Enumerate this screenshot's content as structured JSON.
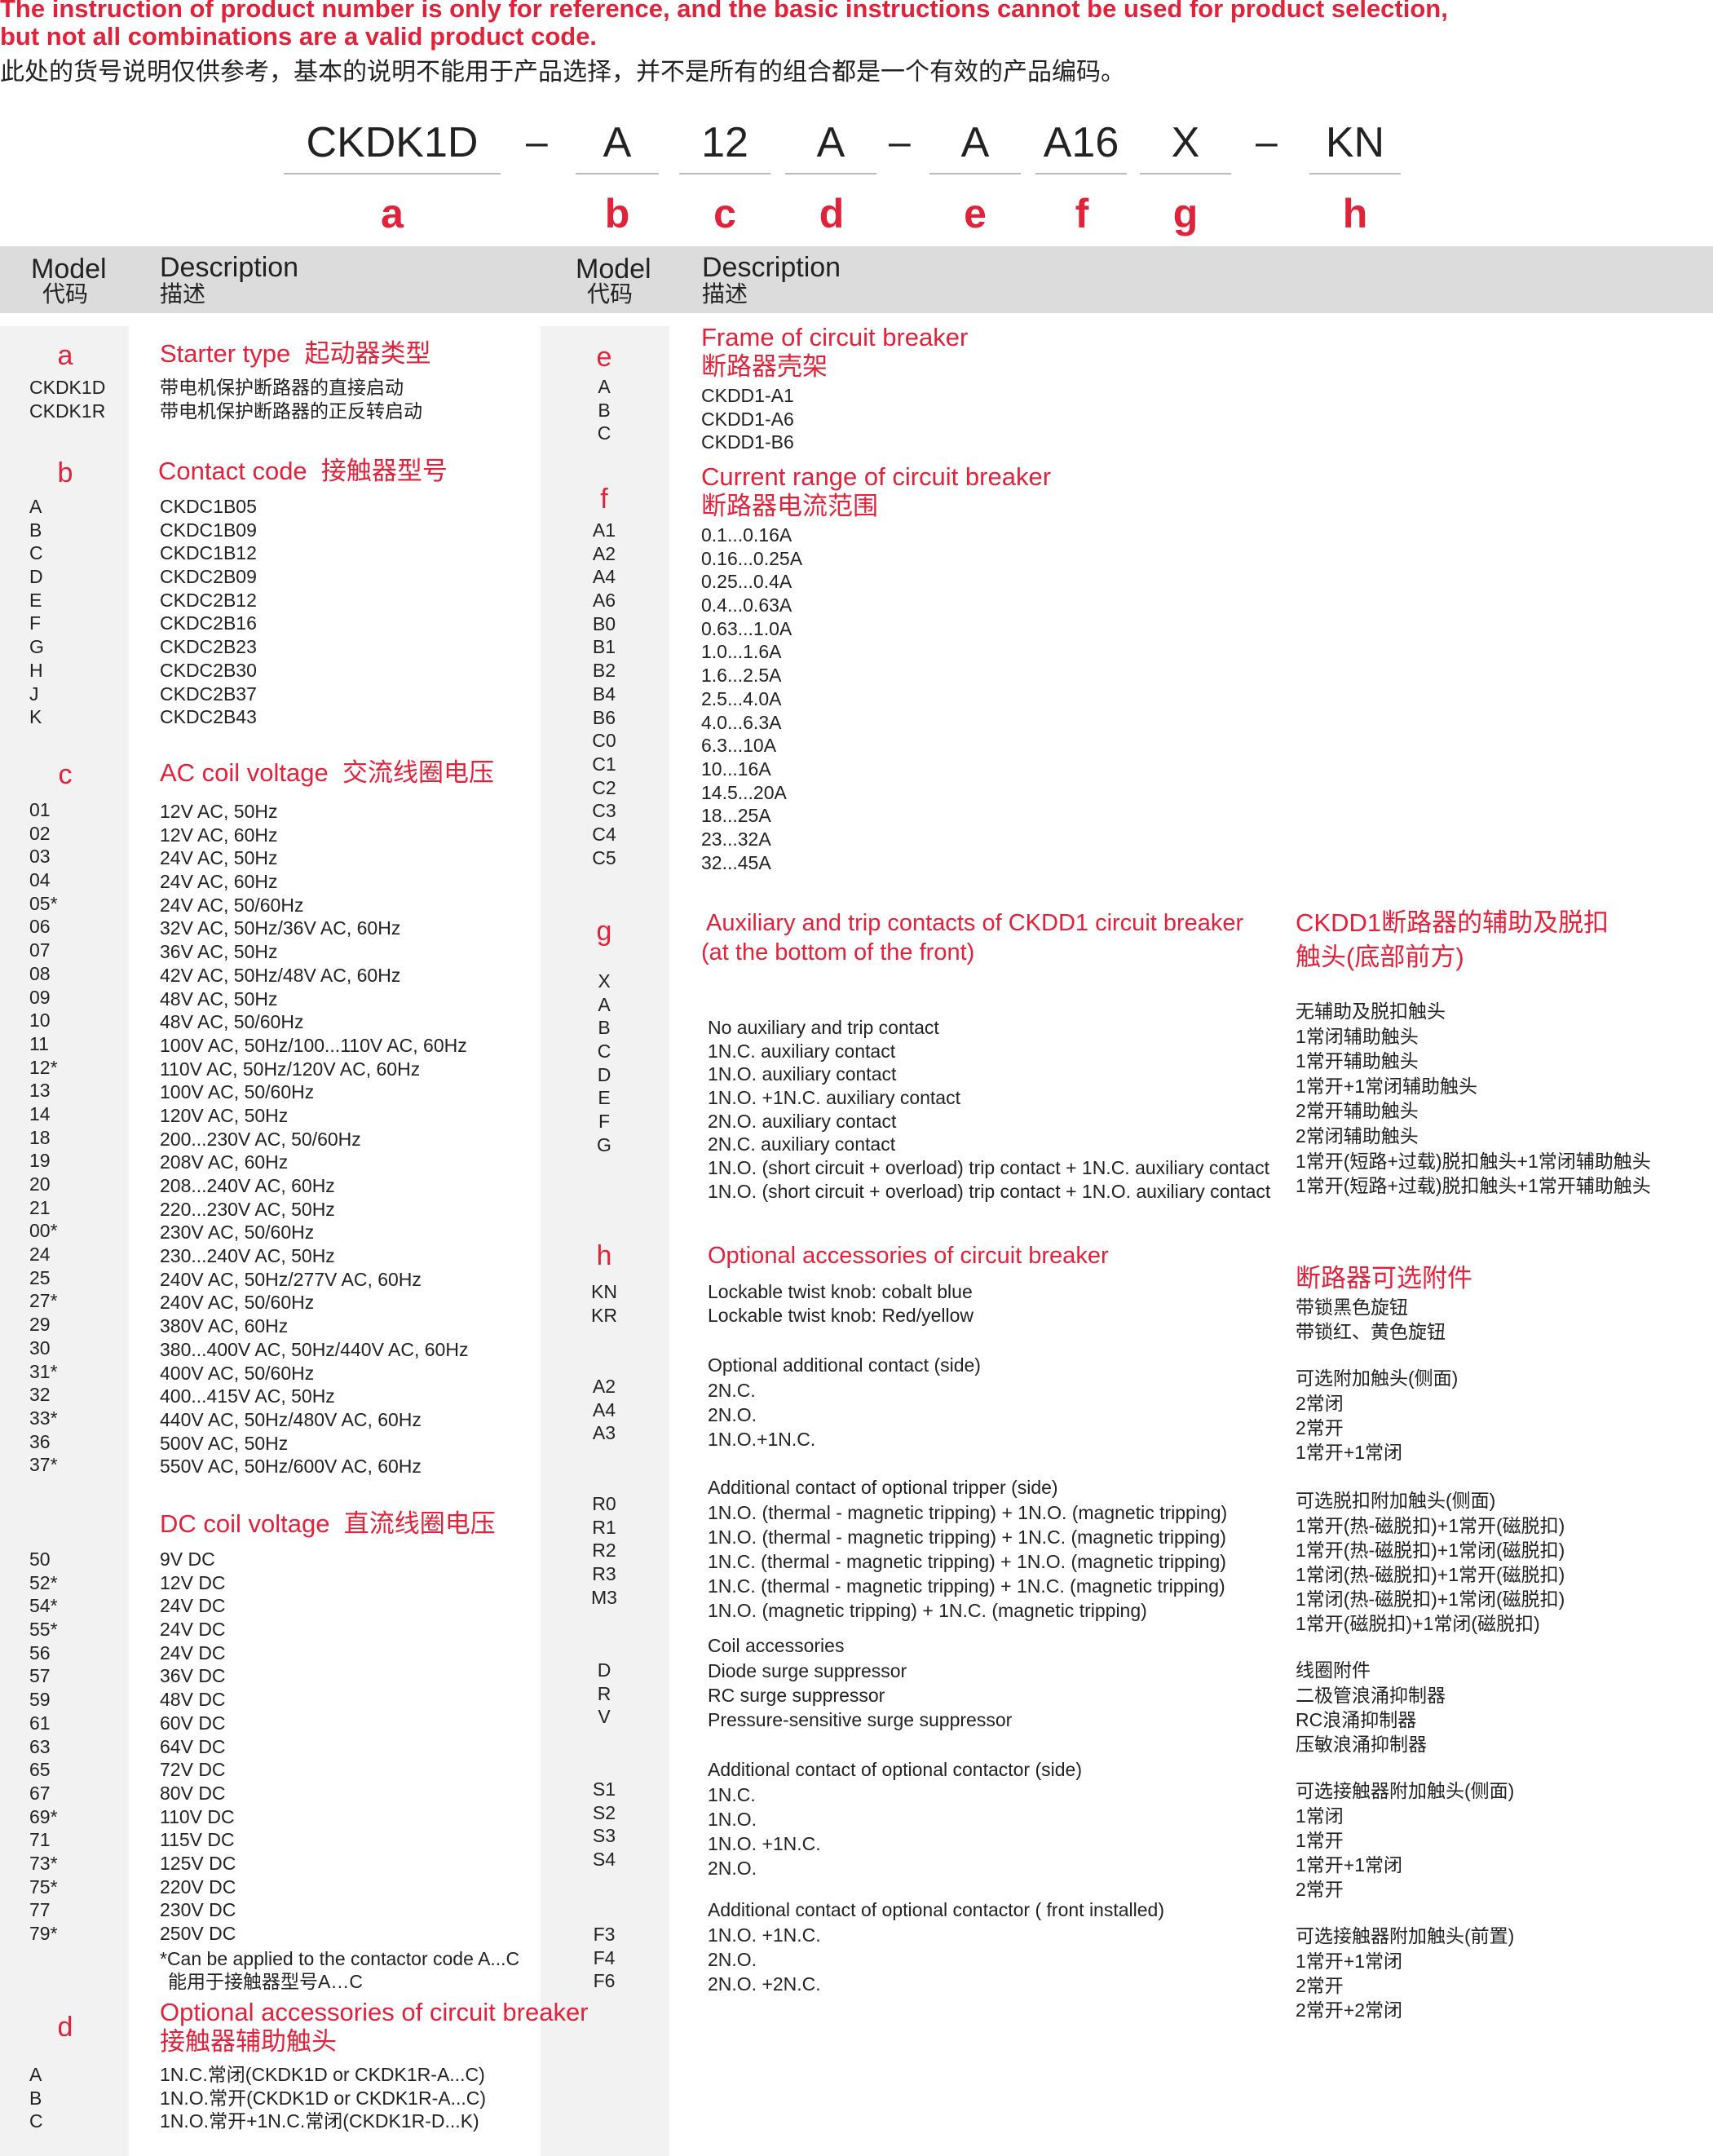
{
  "notice": {
    "line1": "The instruction of product number is only for reference, and the basic instructions cannot be used for product selection,",
    "line2": "but not all combinations are a valid product code.",
    "line_cn": "此处的货号说明仅供参考，基本的说明不能用于产品选择，并不是所有的组合都是一个有效的产品编码。"
  },
  "code": {
    "parts": [
      "CKDK1D",
      "A",
      "12",
      "A",
      "A",
      "A16",
      "X",
      "KN"
    ],
    "dash": "–",
    "letters": [
      "a",
      "b",
      "c",
      "d",
      "e",
      "f",
      "g",
      "h"
    ]
  },
  "header": {
    "model": "Model",
    "model_cn": "代码",
    "description": "Description",
    "description_cn": "描述"
  },
  "sec_a": {
    "letter": "a",
    "title": "Starter type",
    "title_cn": "起动器类型",
    "codes": [
      "CKDK1D",
      "CKDK1R"
    ],
    "descs": [
      "带电机保护断路器的直接启动",
      "带电机保护断路器的正反转启动"
    ]
  },
  "sec_b": {
    "letter": "b",
    "title": "Contact code",
    "title_cn": "接触器型号",
    "codes": [
      "A",
      "B",
      "C",
      "D",
      "E",
      "F",
      "G",
      "H",
      "J",
      "K"
    ],
    "descs": [
      "CKDC1B05",
      "CKDC1B09",
      "CKDC1B12",
      "CKDC2B09",
      "CKDC2B12",
      "CKDC2B16",
      "CKDC2B23",
      "CKDC2B30",
      "CKDC2B37",
      "CKDC2B43"
    ]
  },
  "sec_c": {
    "letter": "c",
    "title": "AC coil voltage",
    "title_cn": "交流线圈电压",
    "codes": [
      "01",
      "02",
      "03",
      "04",
      "05*",
      "06",
      "07",
      "08",
      "09",
      "10",
      "11",
      "12*",
      "13",
      "14",
      "18",
      "19",
      "20",
      "21",
      "00*",
      "24",
      "25",
      "27*",
      "29",
      "30",
      "31*",
      "32",
      "33*",
      "36",
      "37*"
    ],
    "descs": [
      "12V AC, 50Hz",
      "12V AC, 60Hz",
      "24V AC, 50Hz",
      "24V AC, 60Hz",
      "24V AC, 50/60Hz",
      "32V AC, 50Hz/36V AC, 60Hz",
      "36V AC, 50Hz",
      "42V AC, 50Hz/48V AC, 60Hz",
      "48V AC, 50Hz",
      "48V AC, 50/60Hz",
      "100V AC, 50Hz/100...110V AC, 60Hz",
      "110V AC, 50Hz/120V AC, 60Hz",
      "100V AC, 50/60Hz",
      "120V AC, 50Hz",
      "200...230V AC, 50/60Hz",
      "208V AC, 60Hz",
      "208...240V AC, 60Hz",
      "220...230V AC, 50Hz",
      "230V AC, 50/60Hz",
      "230...240V AC, 50Hz",
      "240V AC, 50Hz/277V AC, 60Hz",
      "240V AC, 50/60Hz",
      "380V AC, 60Hz",
      "380...400V AC, 50Hz/440V AC, 60Hz",
      "400V AC, 50/60Hz",
      "400...415V AC, 50Hz",
      "440V AC, 50Hz/480V AC, 60Hz",
      "500V AC, 50Hz",
      "550V AC, 50Hz/600V AC, 60Hz"
    ],
    "dc_title": "DC coil voltage",
    "dc_title_cn": "直流线圈电压",
    "dc_codes": [
      "50",
      "52*",
      "54*",
      "55*",
      "56",
      "57",
      "59",
      "61",
      "63",
      "65",
      "67",
      "69*",
      "71",
      "73*",
      "75*",
      "77",
      "79*"
    ],
    "dc_descs": [
      "9V DC",
      "12V DC",
      "24V DC",
      "24V DC",
      "24V DC",
      "36V DC",
      "48V DC",
      "60V DC",
      "64V DC",
      "72V DC",
      "80V DC",
      "110V DC",
      "115V DC",
      "125V DC",
      "220V DC",
      "230V DC",
      "250V DC"
    ],
    "note": "*Can be applied to the contactor code A...C",
    "note_cn": "能用于接触器型号A…C"
  },
  "sec_d": {
    "letter": "d",
    "title": "Optional accessories of circuit breaker",
    "title_cn": "接触器辅助触头",
    "codes": [
      "A",
      "B",
      "C"
    ],
    "descs": [
      "1N.C.常闭(CKDK1D or CKDK1R-A...C)",
      "1N.O.常开(CKDK1D or CKDK1R-A...C)",
      "1N.O.常开+1N.C.常闭(CKDK1R-D...K)"
    ]
  },
  "sec_e": {
    "letter": "e",
    "title": "Frame of circuit breaker",
    "title_cn": "断路器壳架",
    "codes": [
      "A",
      "B",
      "C"
    ],
    "descs": [
      "CKDD1-A1",
      "CKDD1-A6",
      "CKDD1-B6"
    ]
  },
  "sec_f": {
    "letter": "f",
    "title": "Current range of circuit breaker",
    "title_cn": "断路器电流范围",
    "codes": [
      "A1",
      "A2",
      "A4",
      "A6",
      "B0",
      "B1",
      "B2",
      "B4",
      "B6",
      "C0",
      "C1",
      "C2",
      "C3",
      "C4",
      "C5"
    ],
    "descs": [
      "0.1...0.16A",
      "0.16...0.25A",
      "0.25...0.4A",
      "0.4...0.63A",
      "0.63...1.0A",
      "1.0...1.6A",
      "1.6...2.5A",
      "2.5...4.0A",
      "4.0...6.3A",
      "6.3...10A",
      "10...16A",
      "14.5...20A",
      "18...25A",
      "23...32A",
      "32...45A"
    ]
  },
  "sec_g": {
    "letter": "g",
    "title1": "Auxiliary and trip contacts of CKDD1 circuit breaker",
    "title2": "(at the bottom of the front)",
    "title_cn1": "CKDD1断路器的辅助及脱扣",
    "title_cn2": "触头(底部前方)",
    "codes": [
      "X",
      "A",
      "B",
      "C",
      "D",
      "E",
      "F",
      "G"
    ],
    "descs": [
      "No auxiliary and trip  contact",
      "1N.C. auxiliary contact",
      "1N.O. auxiliary contact",
      "1N.O. +1N.C. auxiliary contact",
      "2N.O. auxiliary contact",
      "2N.C. auxiliary contact",
      "1N.O. (short circuit + overload) trip  contact + 1N.C. auxiliary contact",
      "1N.O. (short circuit + overload) trip  contact + 1N.O. auxiliary contact"
    ],
    "descs_cn": [
      "无辅助及脱扣触头",
      "1常闭辅助触头",
      "1常开辅助触头",
      "1常开+1常闭辅助触头",
      "2常开辅助触头",
      "2常闭辅助触头",
      "1常开(短路+过载)脱扣触头+1常闭辅助触头",
      "1常开(短路+过载)脱扣触头+1常开辅助触头"
    ]
  },
  "sec_h": {
    "letter": "h",
    "title": "Optional accessories of circuit breaker",
    "title_cn": "断路器可选附件",
    "g1_codes": [
      "KN",
      "KR"
    ],
    "g1_descs": [
      "Lockable twist knob: cobalt blue",
      "Lockable twist knob: Red/yellow"
    ],
    "g1_cn": [
      "带锁黑色旋钮",
      "带锁红、黄色旋钮"
    ],
    "g2_head": "Optional additional contact (side)",
    "g2_head_cn": "可选附加触头(侧面)",
    "g2_codes": [
      "A2",
      "A4",
      "A3"
    ],
    "g2_descs": [
      "2N.C.",
      "2N.O.",
      "1N.O.+1N.C."
    ],
    "g2_cn": [
      "2常闭",
      "2常开",
      "1常开+1常闭"
    ],
    "g3_head": "Additional contact of optional tripper  (side)",
    "g3_head_cn": "可选脱扣附加触头(侧面)",
    "g3_codes": [
      "R0",
      "R1",
      "R2",
      "R3",
      "M3"
    ],
    "g3_descs": [
      "1N.O. (thermal - magnetic tripping) + 1N.O. (magnetic tripping)",
      "1N.O. (thermal - magnetic tripping) + 1N.C. (magnetic tripping)",
      "1N.C. (thermal - magnetic tripping) + 1N.O. (magnetic tripping)",
      "1N.C. (thermal - magnetic tripping) + 1N.C. (magnetic tripping)",
      "1N.O. (magnetic tripping) + 1N.C. (magnetic tripping)"
    ],
    "g3_cn": [
      "1常开(热-磁脱扣)+1常开(磁脱扣)",
      "1常开(热-磁脱扣)+1常闭(磁脱扣)",
      "1常闭(热-磁脱扣)+1常开(磁脱扣)",
      "1常闭(热-磁脱扣)+1常闭(磁脱扣)",
      "1常开(磁脱扣)+1常闭(磁脱扣)"
    ],
    "g4_head": "Coil accessories",
    "g4_head_cn": "线圈附件",
    "g4_codes": [
      "D",
      "R",
      "V"
    ],
    "g4_descs": [
      "Diode surge suppressor",
      "RC surge suppressor",
      "Pressure-sensitive surge suppressor"
    ],
    "g4_cn": [
      "二极管浪涌抑制器",
      "RC浪涌抑制器",
      "压敏浪涌抑制器"
    ],
    "g5_head": "Additional contact of optional contactor (side)",
    "g5_head_cn": "可选接触器附加触头(侧面)",
    "g5_codes": [
      "S1",
      "S2",
      "S3",
      "S4"
    ],
    "g5_descs": [
      "1N.C.",
      "1N.O.",
      "1N.O. +1N.C.",
      "2N.O."
    ],
    "g5_cn": [
      "1常闭",
      "1常开",
      "1常开+1常闭",
      "2常开"
    ],
    "g6_head": "Additional contact of optional contactor ( front installed)",
    "g6_head_cn": "可选接触器附加触头(前置)",
    "g6_codes": [
      "F3",
      "F4",
      "F6"
    ],
    "g6_descs": [
      "1N.O. +1N.C.",
      "2N.O.",
      "2N.O. +2N.C."
    ],
    "g6_cn": [
      "1常开+1常闭",
      "2常开",
      "2常开+2常闭"
    ]
  },
  "colors": {
    "accent": "#e0223a",
    "header_bg": "#dcdcdc",
    "strip_bg": "#f2f2f2",
    "text": "#222222"
  }
}
